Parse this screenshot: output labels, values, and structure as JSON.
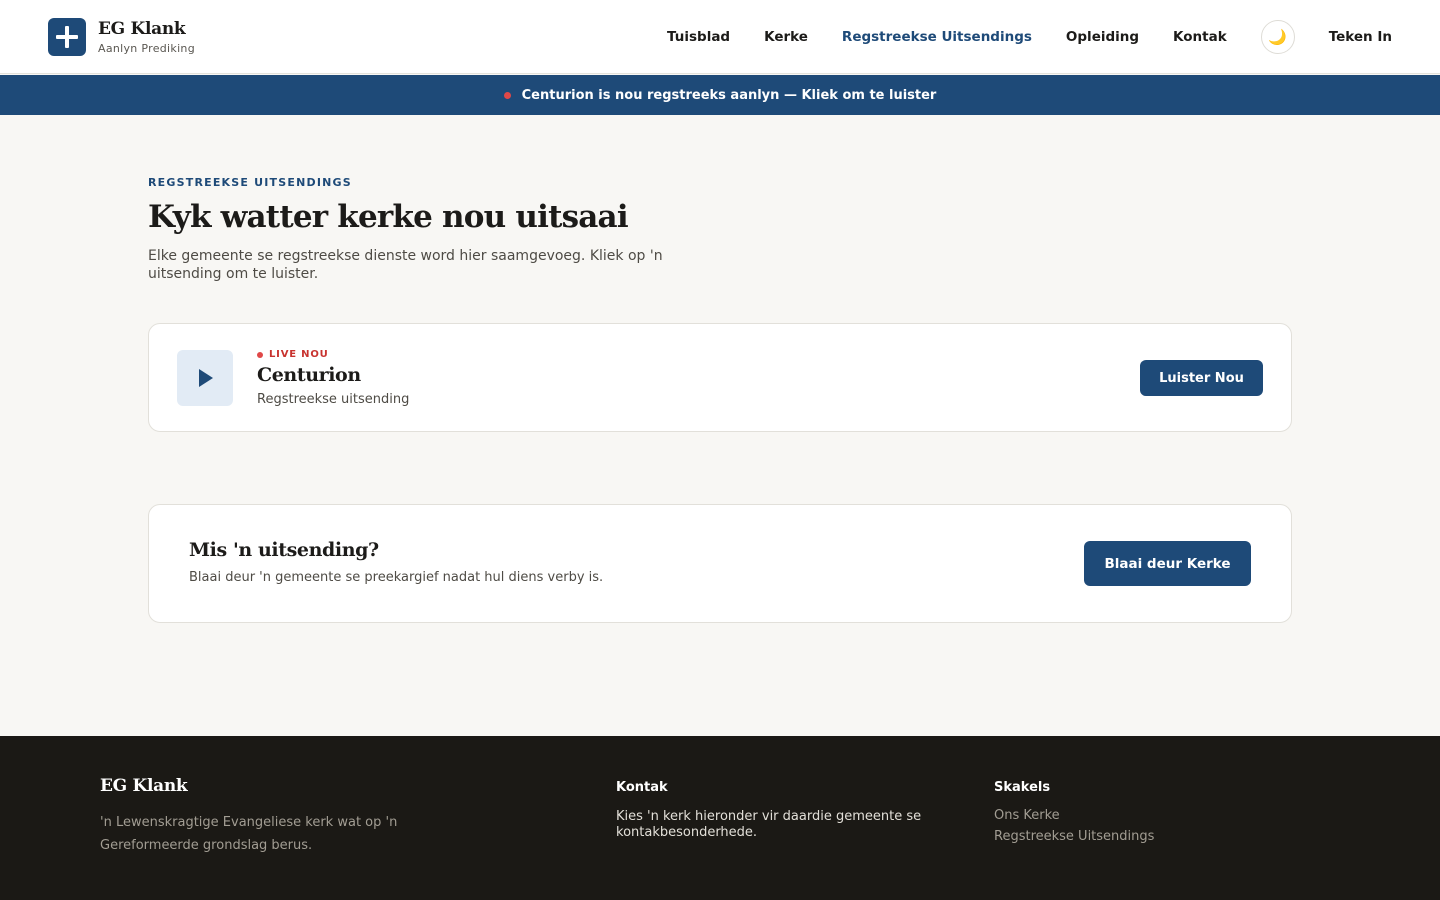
{
  "brand": {
    "name": "EG Klank",
    "tagline": "Aanlyn Prediking"
  },
  "nav": {
    "items": [
      {
        "label": "Tuisblad",
        "active": false
      },
      {
        "label": "Kerke",
        "active": false
      },
      {
        "label": "Regstreekse Uitsendings",
        "active": true
      },
      {
        "label": "Opleiding",
        "active": false
      },
      {
        "label": "Kontak",
        "active": false
      }
    ],
    "theme_icon": "🌙",
    "signin_label": "Teken In"
  },
  "banner": {
    "text": "Centurion is nou regstreeks aanlyn — Kliek om te luister"
  },
  "main": {
    "eyebrow": "REGSTREEKSE UITSENDINGS",
    "title": "Kyk watter kerke nou uitsaai",
    "description": "Elke gemeente se regstreekse dienste word hier saamgevoeg. Kliek op 'n uitsending om te luister."
  },
  "live_broadcasts": [
    {
      "status": "LIVE NOU",
      "name": "Centurion",
      "subtitle": "Regstreekse uitsending",
      "button_label": "Luister Nou"
    }
  ],
  "missed": {
    "title": "Mis 'n uitsending?",
    "description": "Blaai deur 'n gemeente se preekargief nadat hul diens verby is.",
    "button_label": "Blaai deur Kerke"
  },
  "footer": {
    "brand": "EG Klank",
    "tagline": "'n Lewenskragtige Evangeliese kerk wat op 'n Gereformeerde grondslag berus.",
    "contact_heading": "Kontak",
    "contact_text": "Kies 'n kerk hieronder vir daardie gemeente se kontakbesonderhede.",
    "links_heading": "Skakels",
    "links": [
      "Ons Kerke",
      "Regstreekse Uitsendings"
    ]
  },
  "colors": {
    "primary": "#1e4a78",
    "live_red": "#e04848",
    "background": "#f8f7f4",
    "footer_bg": "#1b1915"
  },
  "icons": {
    "logo": "cross-icon",
    "theme": "moon-icon",
    "play": "play-icon",
    "live": "live-dot-icon"
  }
}
